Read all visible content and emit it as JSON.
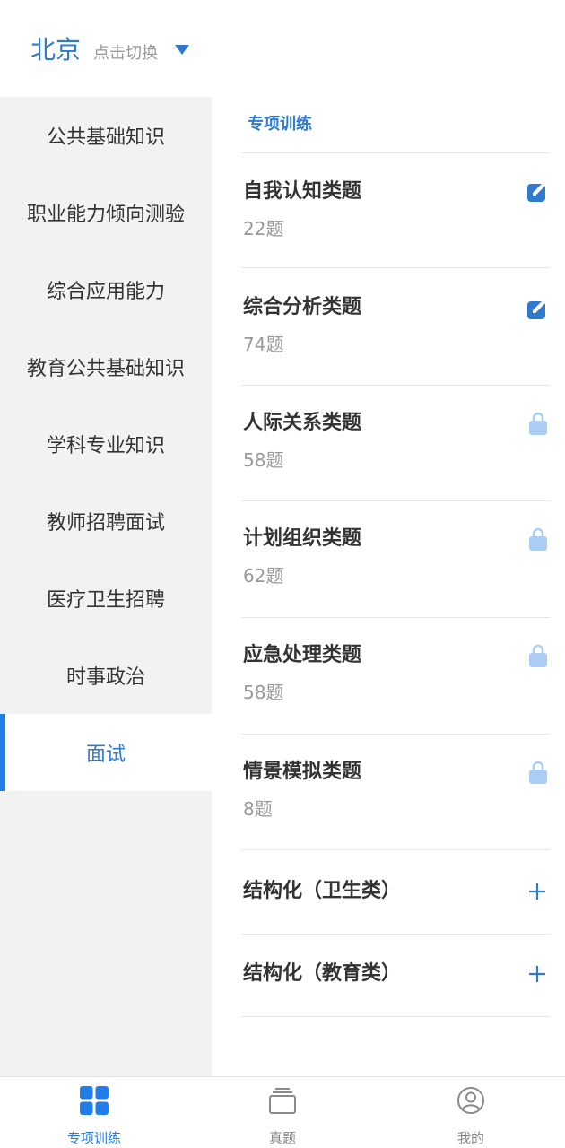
{
  "header": {
    "city": "北京",
    "switch_label": "点击切换"
  },
  "sidebar": {
    "items": [
      {
        "label": "公共基础知识"
      },
      {
        "label": "职业能力倾向测验"
      },
      {
        "label": "综合应用能力"
      },
      {
        "label": "教育公共基础知识"
      },
      {
        "label": "学科专业知识"
      },
      {
        "label": "教师招聘面试"
      },
      {
        "label": "医疗卫生招聘"
      },
      {
        "label": "时事政治"
      },
      {
        "label": "面试"
      }
    ],
    "active_index": 8
  },
  "main": {
    "section_title": "专项训练",
    "rows": [
      {
        "title": "自我认知类题",
        "count": "22题",
        "icon": "edit-icon"
      },
      {
        "title": "综合分析类题",
        "count": "74题",
        "icon": "edit-icon"
      },
      {
        "title": "人际关系类题",
        "count": "58题",
        "icon": "lock-icon"
      },
      {
        "title": "计划组织类题",
        "count": "62题",
        "icon": "lock-icon"
      },
      {
        "title": "应急处理类题",
        "count": "58题",
        "icon": "lock-icon"
      },
      {
        "title": "情景模拟类题",
        "count": "8题",
        "icon": "lock-icon"
      },
      {
        "title": "结构化（卫生类）",
        "icon": "plus-icon"
      },
      {
        "title": "结构化（教育类）",
        "icon": "plus-icon"
      }
    ]
  },
  "tabbar": {
    "tabs": [
      {
        "label": "专项训练",
        "icon": "grid-icon",
        "active": true
      },
      {
        "label": "真题",
        "icon": "stack-icon",
        "active": false
      },
      {
        "label": "我的",
        "icon": "user-icon",
        "active": false
      }
    ]
  },
  "colors": {
    "accent": "#2f7ad1",
    "tab_active": "#1f7ee8",
    "lock": "#a9cdf5",
    "sidebar_bg": "#f2f2f2",
    "muted_text": "#999999"
  }
}
